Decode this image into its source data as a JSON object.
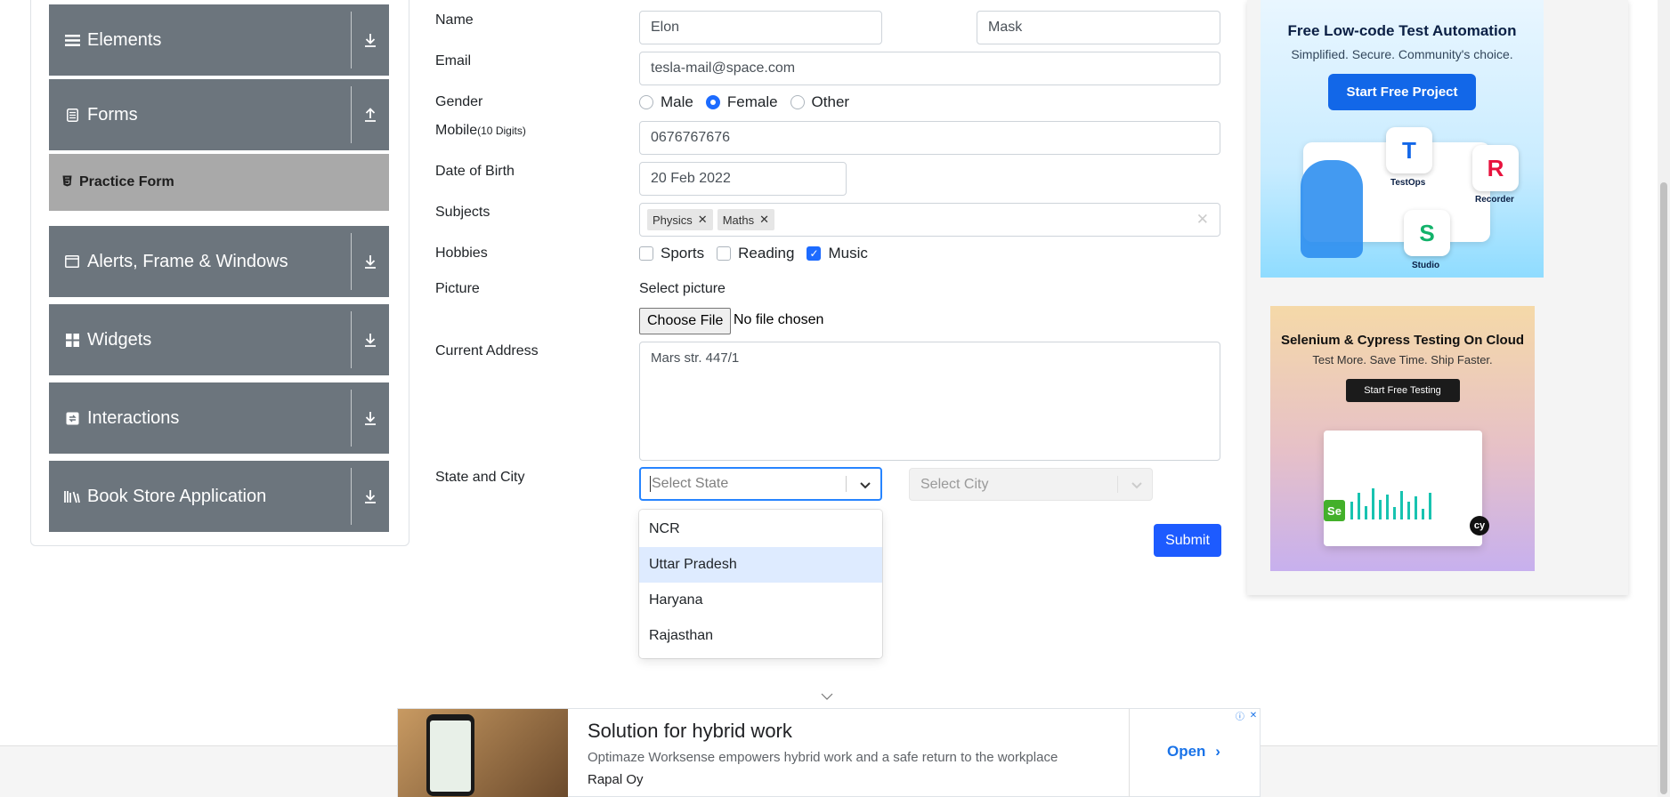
{
  "sidebar": {
    "groups": [
      {
        "label": "Elements",
        "icon": "hamburger-icon",
        "arrow": "download-icon"
      },
      {
        "label": "Forms",
        "icon": "document-icon",
        "arrow": "upload-icon"
      },
      {
        "label": "Alerts, Frame & Windows",
        "icon": "window-icon",
        "arrow": "download-icon"
      },
      {
        "label": "Widgets",
        "icon": "widgets-icon",
        "arrow": "download-icon"
      },
      {
        "label": "Interactions",
        "icon": "interactions-icon",
        "arrow": "download-icon"
      },
      {
        "label": "Book Store Application",
        "icon": "books-icon",
        "arrow": "download-icon"
      }
    ],
    "active_item": "Practice Form"
  },
  "form": {
    "name_label": "Name",
    "first_name": "Elon",
    "last_name": "Mask",
    "email_label": "Email",
    "email": "tesla-mail@space.com",
    "gender_label": "Gender",
    "gender_options": [
      "Male",
      "Female",
      "Other"
    ],
    "gender_selected": "Female",
    "mobile_label": "Mobile",
    "mobile_hint": "(10 Digits)",
    "mobile": "0676767676",
    "dob_label": "Date of Birth",
    "dob": "20 Feb 2022",
    "subjects_label": "Subjects",
    "subjects": [
      "Physics",
      "Maths"
    ],
    "hobbies_label": "Hobbies",
    "hobbies": [
      "Sports",
      "Reading",
      "Music"
    ],
    "hobbies_checked": [
      "Music"
    ],
    "picture_label": "Picture",
    "picture_caption": "Select picture",
    "choose_file": "Choose File",
    "no_file": "No file chosen",
    "address_label": "Current Address",
    "address": "Mars str. 447/1",
    "state_city_label": "State and City",
    "state_placeholder": "Select State",
    "city_placeholder": "Select City",
    "state_options": [
      "NCR",
      "Uttar Pradesh",
      "Haryana",
      "Rajasthan"
    ],
    "state_focused": "Uttar Pradesh",
    "submit": "Submit"
  },
  "ads": {
    "katalon": {
      "title": "Free Low-code Test Automation",
      "subtitle": "Simplified. Secure. Community's choice.",
      "button": "Start Free Project",
      "tools": [
        "TestOps",
        "Recorder",
        "Studio"
      ]
    },
    "lambdatest": {
      "title": "Selenium & Cypress Testing On Cloud",
      "subtitle": "Test More. Save Time. Ship Faster.",
      "button": "Start Free Testing"
    },
    "bottom": {
      "headline": "Solution for hybrid work",
      "description": "Optimaze Worksense empowers hybrid work and a safe return to the workplace",
      "brand": "Rapal Oy",
      "cta": "Open"
    }
  },
  "colors": {
    "sidebar_group": "#6c757d",
    "sidebar_active": "#a9a9a9",
    "primary": "#1d5bff",
    "option_focus": "#deebff"
  }
}
